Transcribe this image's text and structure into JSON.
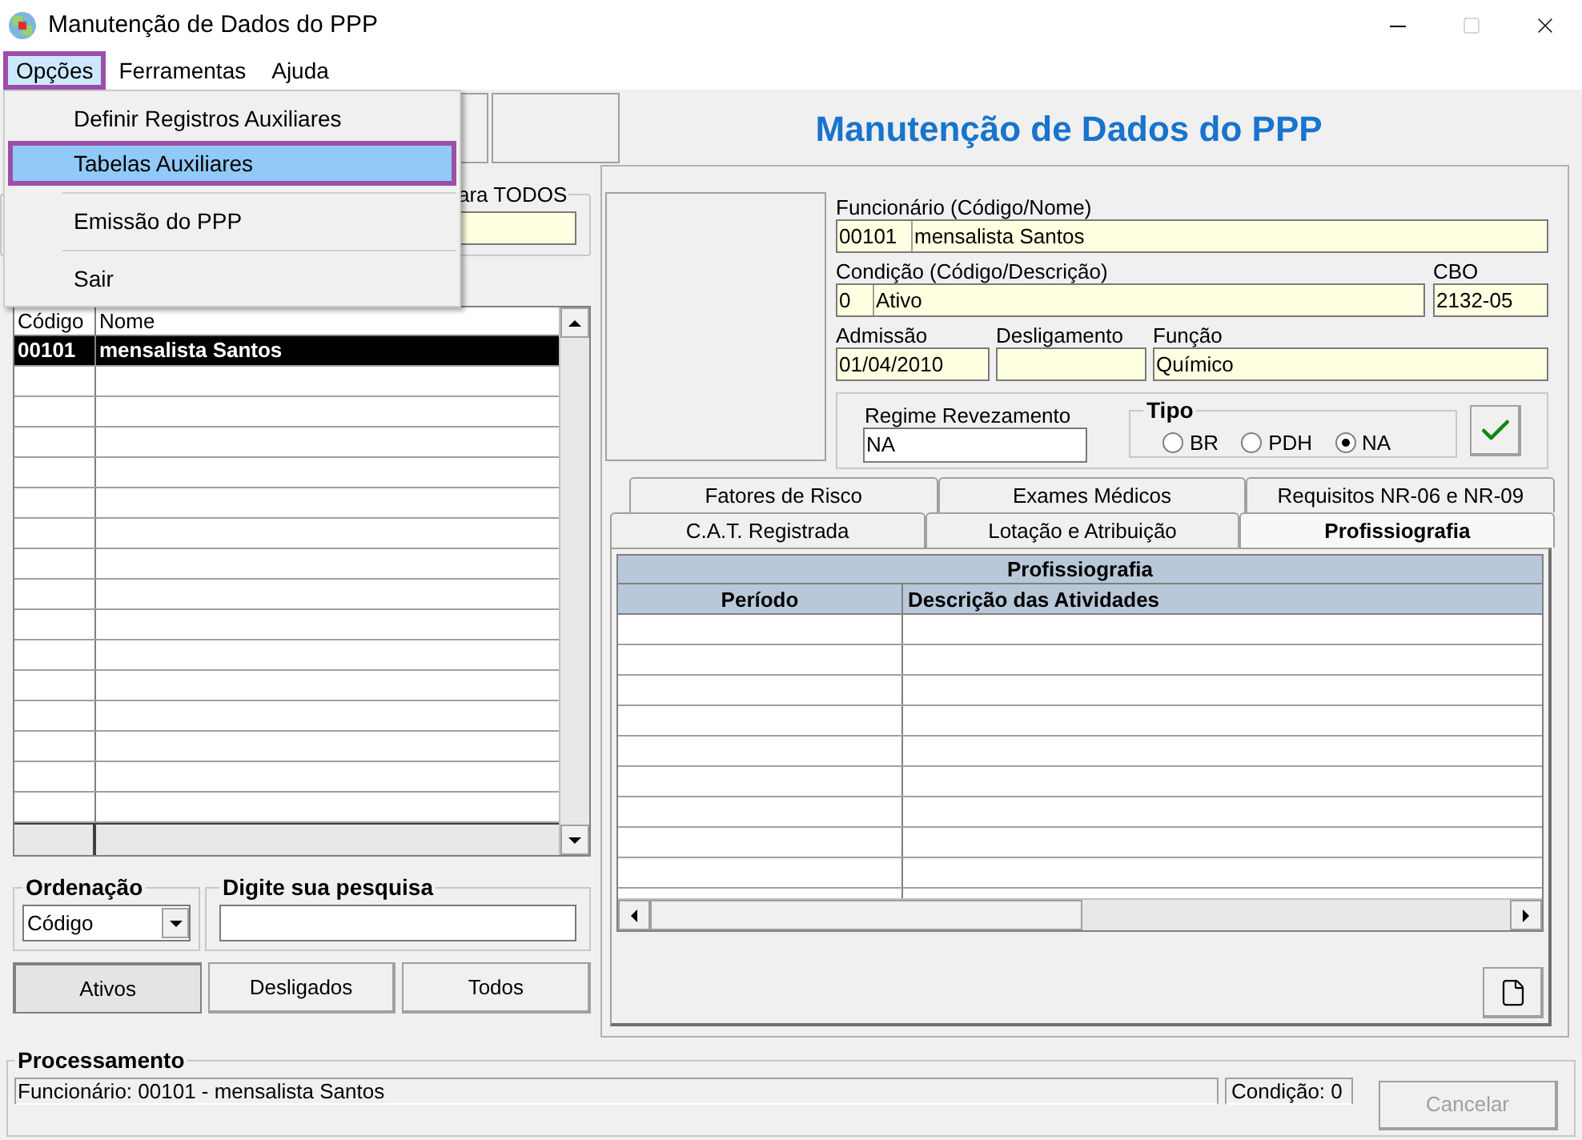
{
  "window": {
    "title": "Manutenção de Dados do PPP"
  },
  "menu": [
    {
      "label": "Opções",
      "selected": true
    },
    {
      "label": "Ferramentas",
      "selected": false
    },
    {
      "label": "Ajuda",
      "selected": false
    }
  ],
  "dropdown": [
    {
      "kind": "item",
      "label": "Definir Registros Auxiliares",
      "selected": false
    },
    {
      "kind": "item",
      "label": "Tabelas Auxiliares",
      "selected": true
    },
    {
      "kind": "separator"
    },
    {
      "kind": "item",
      "label": "Emissão do PPP",
      "selected": false
    },
    {
      "kind": "separator"
    },
    {
      "kind": "item",
      "label": "Sair",
      "selected": false
    }
  ],
  "heading": "Manutenção de Dados do PPP",
  "filter_group": {
    "label": "ara TODOS"
  },
  "employee_list": {
    "columns": [
      "Código",
      "Nome"
    ],
    "rows": [
      {
        "code": "00101",
        "name": "mensalista Santos",
        "selected": true
      }
    ]
  },
  "ordering": {
    "label": "Ordenação",
    "value": "Código"
  },
  "search": {
    "label": "Digite sua pesquisa"
  },
  "filter_buttons": [
    {
      "label": "Ativos",
      "selected": true
    },
    {
      "label": "Desligados",
      "selected": false
    },
    {
      "label": "Todos",
      "selected": false
    }
  ],
  "employee": {
    "label": "Funcionário (Código/Nome)",
    "code": "00101",
    "name": "mensalista Santos"
  },
  "condition": {
    "label": "Condição (Código/Descrição)",
    "code": "0",
    "description": "Ativo"
  },
  "cbo": {
    "label": "CBO",
    "value": "2132-05"
  },
  "admission": {
    "label": "Admissão",
    "value": "01/04/2010"
  },
  "dismissal": {
    "label": "Desligamento"
  },
  "job": {
    "label": "Função",
    "value": "Químico"
  },
  "shift": {
    "label": "Regime Revezamento",
    "value": "NA"
  },
  "tipo": {
    "label": "Tipo",
    "options": [
      {
        "label": "BR",
        "selected": false
      },
      {
        "label": "PDH",
        "selected": false
      },
      {
        "label": "NA",
        "selected": true
      }
    ]
  },
  "tabs_back": [
    {
      "label": "Fatores de Risco",
      "selected": false
    },
    {
      "label": "Exames Médicos",
      "selected": false
    },
    {
      "label": "Requisitos NR-06 e NR-09",
      "selected": false
    }
  ],
  "tabs_front": [
    {
      "label": "C.A.T. Registrada",
      "selected": false
    },
    {
      "label": "Lotação e Atribuição",
      "selected": false
    },
    {
      "label": "Profissiografia",
      "selected": true
    }
  ],
  "profile_table": {
    "title": "Profissiografia",
    "columns": [
      "Período",
      "Descrição das Atividades"
    ]
  },
  "status": {
    "label": "Processamento",
    "message": "Funcionário: 00101 - mensalista Santos",
    "condition": "Condição: 0",
    "cancel": {
      "label": "Cancelar",
      "disabled": true
    }
  }
}
